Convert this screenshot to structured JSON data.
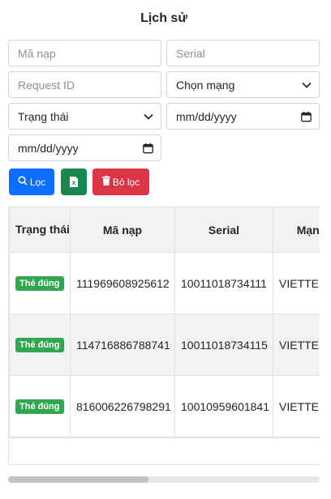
{
  "page": {
    "title": "Lịch sử"
  },
  "filters": {
    "code_placeholder": "Mã nạp",
    "serial_placeholder": "Serial",
    "request_id_placeholder": "Request ID",
    "network_select": "Chọn mạng",
    "status_select": "Trạng thái",
    "date_from": "mm/dd/yyyy",
    "date_to": "mm/dd/yyyy"
  },
  "buttons": {
    "filter_label": "Lọc",
    "excel_label": "x",
    "clear_label": "Bỏ lọc"
  },
  "table": {
    "headers": {
      "status": "Trạng thái",
      "code": "Mã nạp",
      "serial": "Serial",
      "network": "Mạng"
    },
    "rows": [
      {
        "status": "Thẻ đúng",
        "code": "111969608925612",
        "serial": "10011018734111",
        "network": "VIETTEL"
      },
      {
        "status": "Thẻ đúng",
        "code": "114716886788741",
        "serial": "10011018734115",
        "network": "VIETTEL"
      },
      {
        "status": "Thẻ đúng",
        "code": "816006226798291",
        "serial": "10010959601841",
        "network": "VIETTEL"
      }
    ]
  },
  "colors": {
    "primary": "#0d6efd",
    "success": "#198754",
    "danger": "#dc3545",
    "badge": "#2fa84f"
  },
  "scroll": {
    "position_fraction": 0.0,
    "visible_fraction": 0.45
  }
}
